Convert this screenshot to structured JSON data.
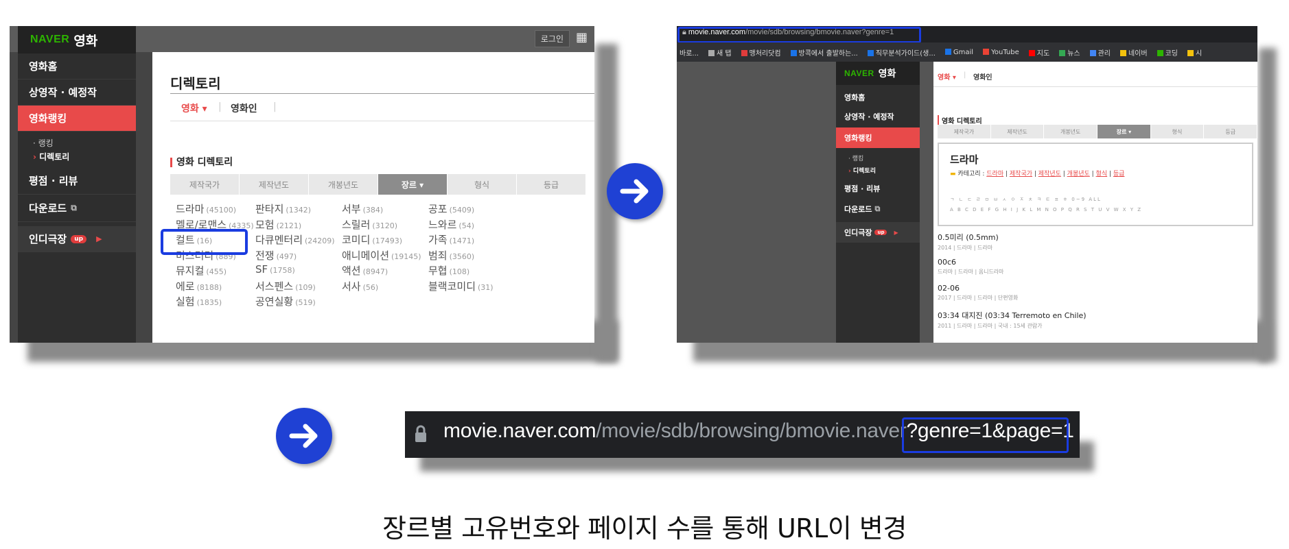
{
  "screen1": {
    "brand": "NAVER",
    "service": "영화",
    "login_label": "로그인",
    "nav_items": [
      "영화홈",
      "상영작 · 예정작",
      "영화랭킹",
      "평점 · 리뷰",
      "다운로드",
      "인디극장"
    ],
    "sub_items": [
      "랭킹",
      "디렉토리"
    ],
    "up_badge": "up",
    "directory_title": "디렉토리",
    "main_tabs": [
      "영화 ▾",
      "영화인"
    ],
    "section_title": "영화 디렉토리",
    "filter_tabs": [
      "제작국가",
      "제작년도",
      "개봉년도",
      "장르 ▾",
      "형식",
      "등급"
    ],
    "genres": [
      {
        "name": "드라마",
        "count": "(45100)"
      },
      {
        "name": "판타지",
        "count": "(1342)"
      },
      {
        "name": "서부",
        "count": "(384)"
      },
      {
        "name": "공포",
        "count": "(5409)"
      },
      {
        "name": "멜로/로맨스",
        "count": "(4335)"
      },
      {
        "name": "모험",
        "count": "(2121)"
      },
      {
        "name": "스릴러",
        "count": "(3120)"
      },
      {
        "name": "느와르",
        "count": "(54)"
      },
      {
        "name": "컬트",
        "count": "(16)"
      },
      {
        "name": "다큐멘터리",
        "count": "(24209)"
      },
      {
        "name": "코미디",
        "count": "(17493)"
      },
      {
        "name": "가족",
        "count": "(1471)"
      },
      {
        "name": "미스터리",
        "count": "(889)"
      },
      {
        "name": "전쟁",
        "count": "(497)"
      },
      {
        "name": "애니메이션",
        "count": "(19145)"
      },
      {
        "name": "범죄",
        "count": "(3560)"
      },
      {
        "name": "뮤지컬",
        "count": "(455)"
      },
      {
        "name": "SF",
        "count": "(1758)"
      },
      {
        "name": "액션",
        "count": "(8947)"
      },
      {
        "name": "무협",
        "count": "(108)"
      },
      {
        "name": "에로",
        "count": "(8188)"
      },
      {
        "name": "서스펜스",
        "count": "(109)"
      },
      {
        "name": "서사",
        "count": "(56)"
      },
      {
        "name": "블랙코미디",
        "count": "(31)"
      },
      {
        "name": "실험",
        "count": "(1835)"
      },
      {
        "name": "공연실황",
        "count": "(519)"
      }
    ]
  },
  "screen2": {
    "url_host": "movie.naver.com",
    "url_path": "/movie/sdb/browsing/bmovie.naver?genre=1",
    "bookmarks": [
      "바로...",
      "새 탭",
      "맹처리닷컴",
      "방콕에서 출발하는...",
      "직무분석가이드(생...",
      "Gmail",
      "YouTube",
      "지도",
      "뉴스",
      "관리",
      "네이버",
      "코딩",
      "시"
    ],
    "brand": "NAVER",
    "service": "영화",
    "nav_items": [
      "영화홈",
      "상영작 · 예정작",
      "영화랭킹",
      "평점 · 리뷰",
      "다운로드",
      "인디극장"
    ],
    "sub_items": [
      "랭킹",
      "디렉토리"
    ],
    "up_badge": "up",
    "main_tabs": [
      "영화 ▾",
      "영화인"
    ],
    "section_title": "영화 디렉토리",
    "filter_tabs": [
      "제작국가",
      "제작년도",
      "개봉년도",
      "장르 ▾",
      "형식",
      "등급"
    ],
    "genre_title": "드라마",
    "category_label": "카테고리 :",
    "category_links": [
      "드라마",
      "제작국가",
      "제작년도",
      "개봉년도",
      "형식",
      "등급"
    ],
    "index_row1": "ㄱ ㄴ ㄷ ㄹ ㅁ ㅂ ㅅ ㅇ ㅈ ㅊ ㅋ ㅌ ㅍ ㅎ 0~9 ALL",
    "index_row2": "A B C D E F G H I J K L M N O P Q R S T U V W X Y Z",
    "movies": [
      {
        "title": "0.5미리 (0.5mm)",
        "meta": "2014 | 드라마 | 드라마"
      },
      {
        "title": "00c6",
        "meta": "드라마 | 드라마 | 옴니드라마"
      },
      {
        "title": "02-06",
        "meta": "2017 | 드라마 | 드라마 | 단편영화"
      },
      {
        "title": "03:34 대지진 (03:34 Terremoto en Chile)",
        "meta": "2011 | 드라마 | 드라마 | 국내 : 15세 관람가"
      }
    ]
  },
  "screen3": {
    "host": "movie.naver.com",
    "path": "/movie/sdb/browsing/bmovie.naver",
    "query": "?genre=1&page=1"
  },
  "caption": "장르별 고유번호와 페이지 수를 통해 URL이 변경",
  "colors": {
    "arrow": "#1f41d4",
    "highlight": "#1a3ce0",
    "active_nav": "#e84a4a",
    "naver_green": "#2db400"
  }
}
